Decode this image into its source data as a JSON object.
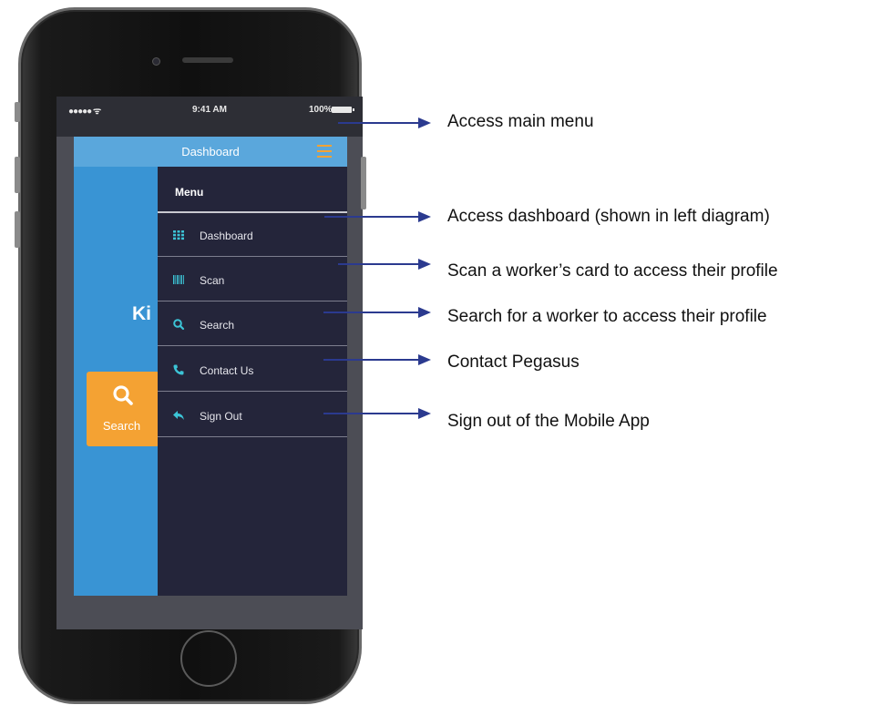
{
  "status_bar": {
    "signal": "●●●●● ᯤ",
    "time": "9:41 AM",
    "battery": "100%"
  },
  "app_bar": {
    "title": "Dashboard",
    "menu_icon": "hamburger-icon"
  },
  "background_screen": {
    "heading_fragment": "Ki",
    "search_tile_label": "Search"
  },
  "drawer": {
    "title": "Menu",
    "items": [
      {
        "label": "Dashboard",
        "icon": "grid-icon"
      },
      {
        "label": "Scan",
        "icon": "barcode-icon"
      },
      {
        "label": "Search",
        "icon": "search-icon"
      },
      {
        "label": "Contact Us",
        "icon": "phone-icon"
      },
      {
        "label": "Sign Out",
        "icon": "reply-arrow-icon"
      }
    ]
  },
  "annotations": [
    "Access main menu",
    "Access dashboard (shown in left diagram)",
    "Scan a worker’s card to access their profile",
    "Search for a worker to access their profile",
    "Contact Pegasus",
    "Sign out of the Mobile App"
  ],
  "colors": {
    "app_bar": "#5aa7dc",
    "app_body": "#3994d4",
    "accent_orange": "#f4a233",
    "drawer": "#24253a",
    "icon_teal": "#3cc4d6",
    "arrow": "#2b3a8f"
  }
}
